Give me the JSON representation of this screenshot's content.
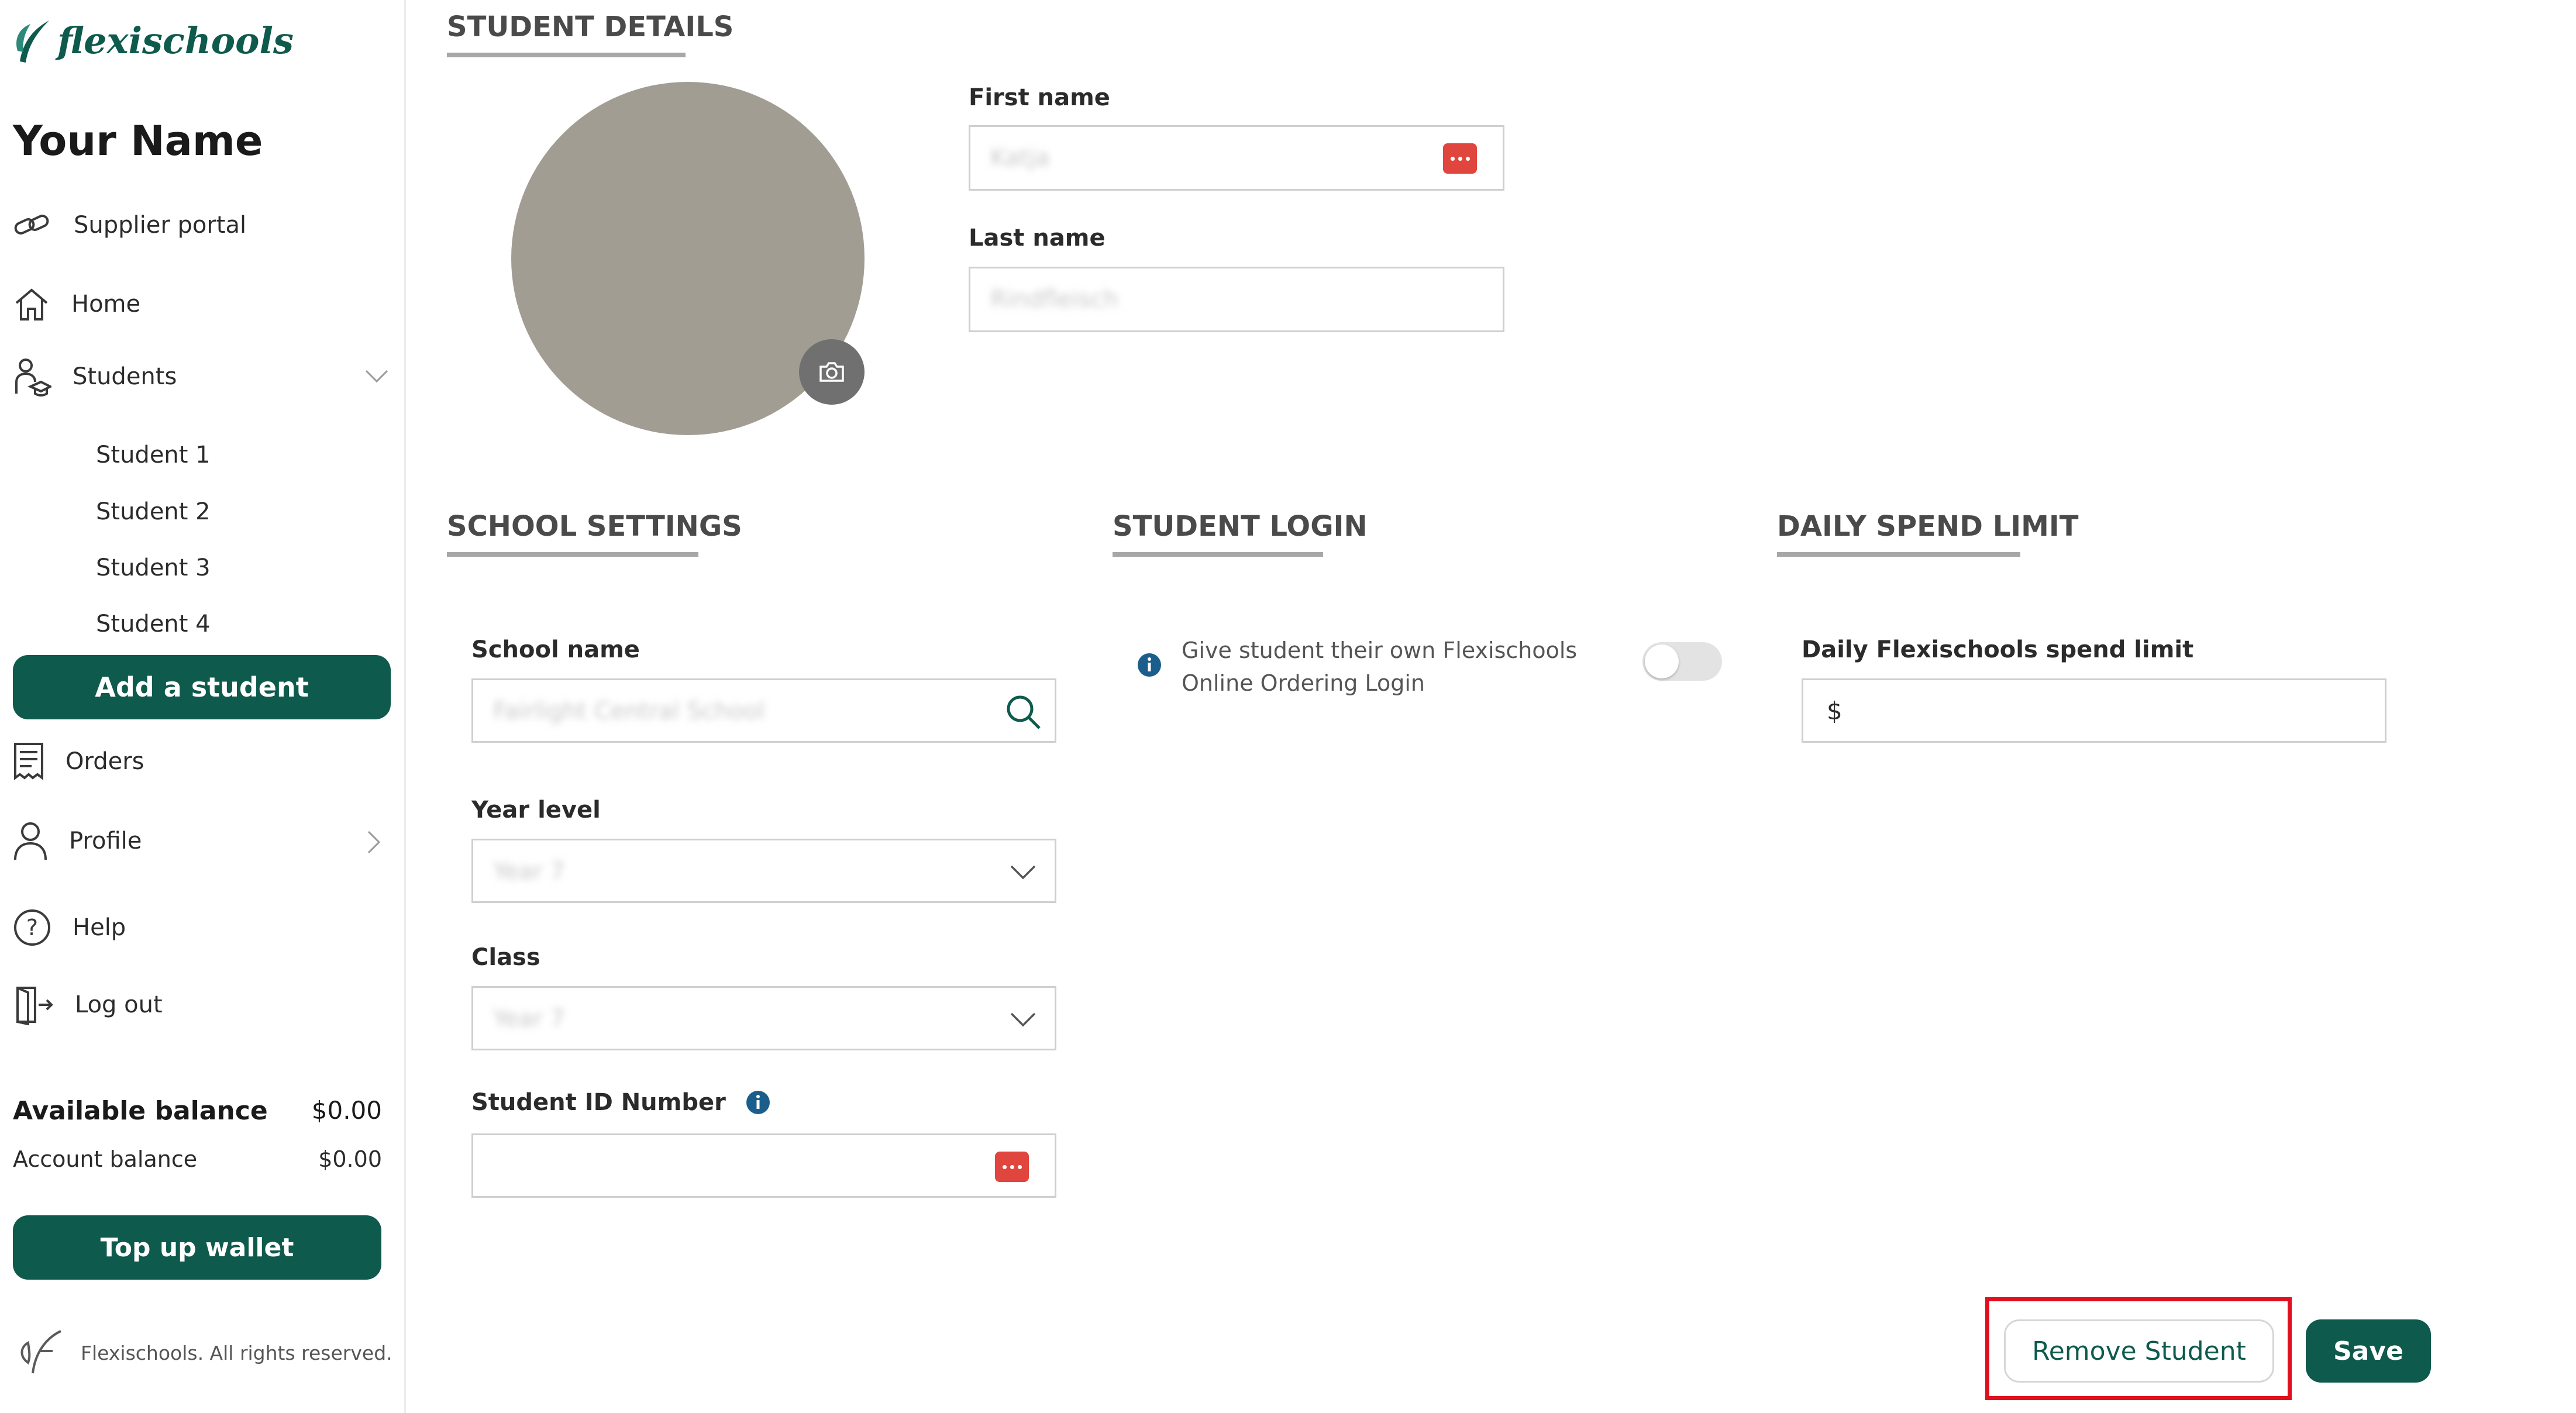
{
  "brand": {
    "name": "flexischools"
  },
  "user": {
    "name": "Your Name"
  },
  "nav": {
    "supplier_portal": "Supplier portal",
    "home": "Home",
    "students": "Students",
    "student_items": [
      "Student 1",
      "Student 2",
      "Student 3",
      "Student 4"
    ],
    "add_student": "Add a student",
    "orders": "Orders",
    "profile": "Profile",
    "help": "Help",
    "logout": "Log out"
  },
  "balance": {
    "available_label": "Available balance",
    "available_value": "$0.00",
    "account_label": "Account balance",
    "account_value": "$0.00",
    "topup": "Top up wallet"
  },
  "footer": {
    "text": "Flexischools. All rights reserved."
  },
  "student_details": {
    "title": "STUDENT DETAILS",
    "first_name_label": "First name",
    "first_name_value": "Katja",
    "last_name_label": "Last name",
    "last_name_value": "Rindfleisch"
  },
  "school_settings": {
    "title": "SCHOOL SETTINGS",
    "school_name_label": "School name",
    "school_name_value": "Fairlight Central School",
    "year_level_label": "Year level",
    "year_level_value": "Year 7",
    "class_label": "Class",
    "class_value": "Year 7",
    "student_id_label": "Student ID Number"
  },
  "student_login": {
    "title": "STUDENT LOGIN",
    "toggle_text": "Give student their own Flexischools Online Ordering Login",
    "toggle_on": false
  },
  "spend_limit": {
    "title": "DAILY SPEND LIMIT",
    "label": "Daily Flexischools spend limit",
    "currency": "$"
  },
  "actions": {
    "remove": "Remove Student",
    "save": "Save"
  },
  "colors": {
    "brand": "#0e5a4d",
    "highlight": "#e0101e",
    "avatar": "#a29d93",
    "info": "#1b5e8c"
  }
}
